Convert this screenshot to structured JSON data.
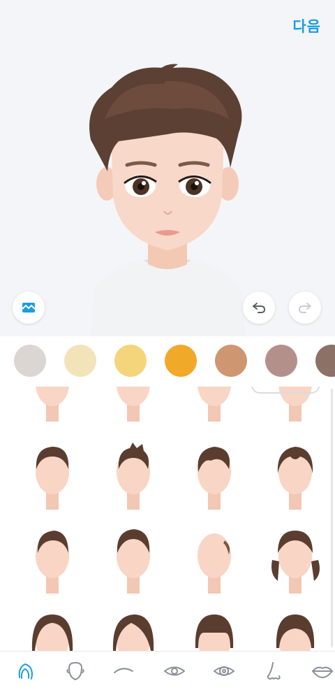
{
  "header": {
    "next_label": "다음"
  },
  "colors": {
    "accent": "#1a9de1",
    "swatches": [
      "#dcd6d2",
      "#f2e3b9",
      "#f4d57c",
      "#f1a92a",
      "#cf9771",
      "#b3918a",
      "#8c7167"
    ]
  },
  "hair_styles": [
    {
      "name": "short-bowl"
    },
    {
      "name": "bangs-short"
    },
    {
      "name": "curtain-fringe"
    },
    {
      "name": "side-part"
    },
    {
      "name": "pompadour"
    },
    {
      "name": "spiky"
    },
    {
      "name": "swept-side"
    },
    {
      "name": "middle-part"
    },
    {
      "name": "undercut"
    },
    {
      "name": "fade-quiff"
    },
    {
      "name": "bald"
    },
    {
      "name": "pigtails"
    },
    {
      "name": "long-bob"
    },
    {
      "name": "side-swept-long"
    },
    {
      "name": "full-bangs"
    },
    {
      "name": "bob-bangs"
    }
  ],
  "selected_style_index": 3,
  "tabs": [
    {
      "name": "hair",
      "active": true
    },
    {
      "name": "face-shape",
      "active": false
    },
    {
      "name": "eyebrows",
      "active": false
    },
    {
      "name": "eyes",
      "active": false
    },
    {
      "name": "eye-color",
      "active": false
    },
    {
      "name": "nose",
      "active": false
    },
    {
      "name": "lips",
      "active": false
    }
  ]
}
